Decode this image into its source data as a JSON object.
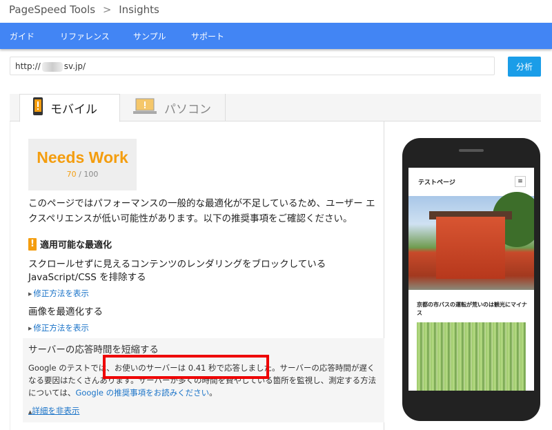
{
  "breadcrumb": {
    "parent": "PageSpeed Tools",
    "separator": ">",
    "current": "Insights"
  },
  "nav": {
    "items": [
      "ガイド",
      "リファレンス",
      "サンプル",
      "サポート"
    ]
  },
  "url_input": {
    "prefix": "http://",
    "suffix": "sv.jp/"
  },
  "analyze_button": "分析",
  "tabs": {
    "mobile": "モバイル",
    "desktop": "パソコン"
  },
  "score": {
    "title": "Needs Work",
    "value": "70",
    "max": "/ 100"
  },
  "summary": "このページではパフォーマンスの一般的な最適化が不足しているため、ユーザー エクスペリエンスが低い可能性があります。以下の推奨事項をご確認ください。",
  "section": {
    "heading": "適用可能な最適化"
  },
  "rules": [
    {
      "title": "スクロールせずに見えるコンテンツのレンダリングをブロックしている JavaScript/CSS を排除する",
      "link": "修正方法を表示"
    },
    {
      "title": "画像を最適化する",
      "link": "修正方法を表示"
    }
  ],
  "expanded_rule": {
    "title": "サーバーの応答時間を短縮する",
    "body_start": "Google のテストでは、",
    "body_highlight": "お使いのサーバーは 0.41 秒で応答しました。",
    "body_rest": "サーバーの応答時間が遅くなる要因はたくさんあります。サーバーが多くの時間を費やしている箇所を監視し、測定する方法については、",
    "body_link": "Google の推奨事項をお読みください",
    "body_end": "。",
    "hide_link": "詳細を非表示"
  },
  "phone_preview": {
    "site_title": "テストページ",
    "menu_icon": "≡",
    "article_title": "京都の市バスの運転が荒いのは観光にマイナス"
  },
  "colors": {
    "nav": "#4285f4",
    "accent": "#f49d0e",
    "button": "#1a9de8",
    "link": "#1a73c8"
  }
}
